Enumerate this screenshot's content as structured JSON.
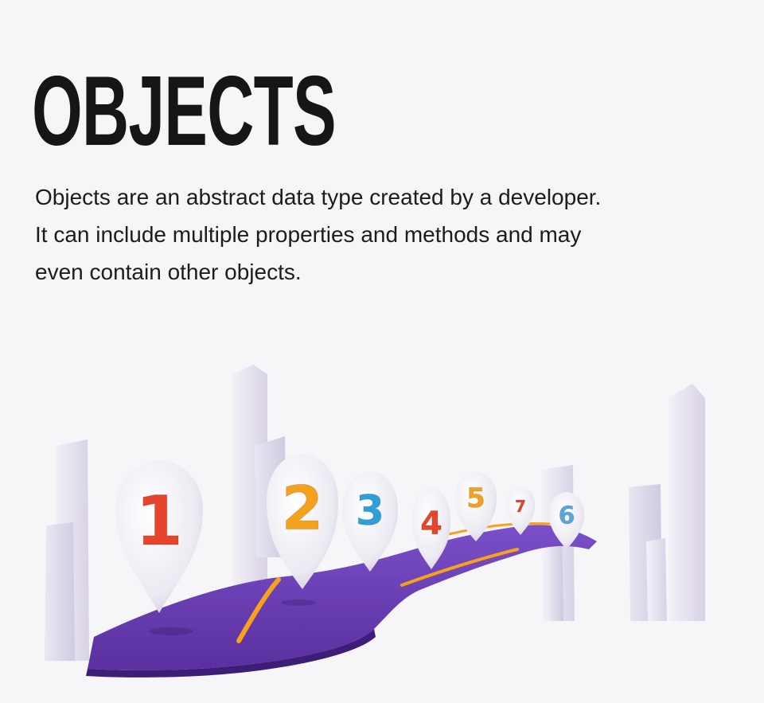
{
  "title": "OBJECTS",
  "description": [
    "Objects are an abstract data type created by a developer.",
    "It can include multiple properties and methods and may",
    "even contain other objects."
  ],
  "illustration": {
    "pins": [
      {
        "label": "1",
        "color": "#e5452a"
      },
      {
        "label": "2",
        "color": "#f4a21d"
      },
      {
        "label": "3",
        "color": "#2f9fd8"
      },
      {
        "label": "4",
        "color": "#e5452a"
      },
      {
        "label": "5",
        "color": "#f4a21d"
      },
      {
        "label": "7",
        "color": "#e5452a"
      },
      {
        "label": "6",
        "color": "#5aa6dc"
      }
    ],
    "road_color": "#6a3fb4",
    "lane_color": "#f7a21b"
  }
}
